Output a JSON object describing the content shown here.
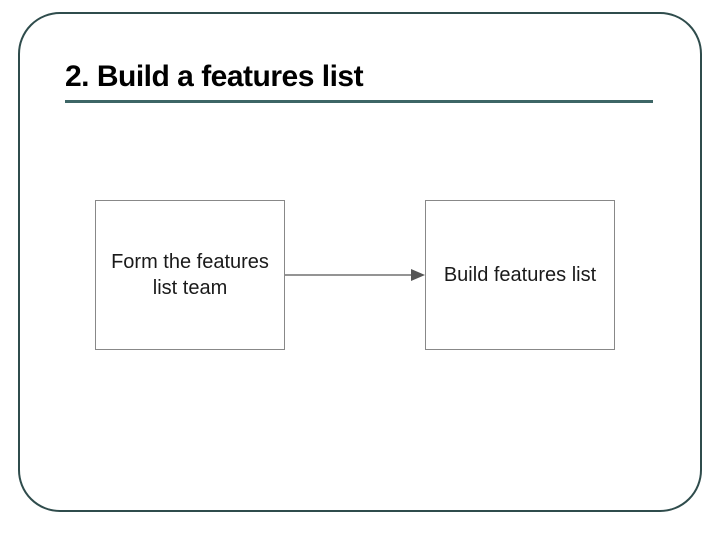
{
  "slide": {
    "title": "2. Build a features list"
  },
  "diagram": {
    "boxes": [
      {
        "label": "Form the features list team"
      },
      {
        "label": "Build features list"
      }
    ]
  },
  "colors": {
    "frame": "#2f4c4c",
    "underline": "#3d6666",
    "box_border": "#888888",
    "text": "#000000"
  }
}
